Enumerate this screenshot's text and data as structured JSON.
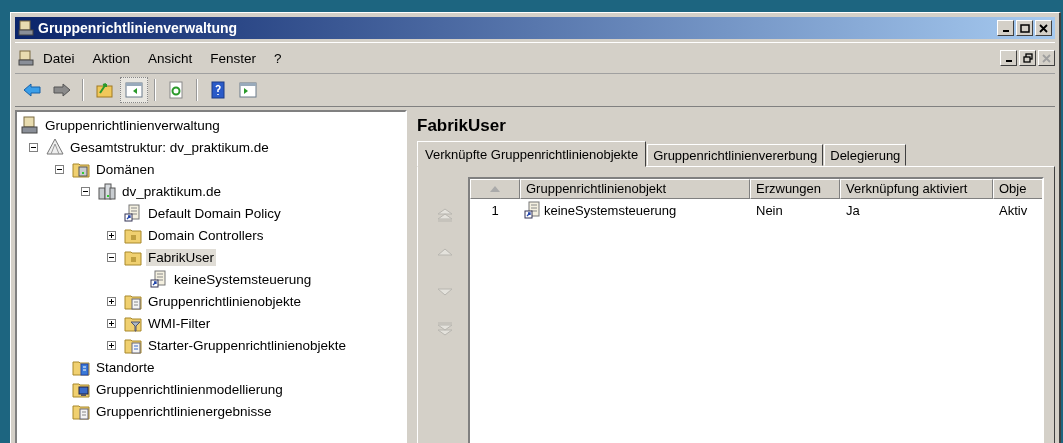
{
  "window": {
    "title": "Gruppenrichtlinienverwaltung"
  },
  "menu": [
    "Datei",
    "Aktion",
    "Ansicht",
    "Fenster",
    "?"
  ],
  "toolbar": [
    {
      "kind": "back",
      "disabled": false
    },
    {
      "kind": "forward",
      "disabled": true
    },
    {
      "kind": "sep"
    },
    {
      "kind": "up-folder"
    },
    {
      "kind": "tree-toggle",
      "selected": true
    },
    {
      "kind": "sep"
    },
    {
      "kind": "refresh"
    },
    {
      "kind": "sep"
    },
    {
      "kind": "help"
    },
    {
      "kind": "action-pane"
    }
  ],
  "tree": [
    {
      "label": "Gruppenrichtlinienverwaltung",
      "kind": "console",
      "selected": false,
      "children": [
        {
          "label": "Gesamtstruktur: dv_praktikum.de",
          "kind": "forest",
          "expanded": true,
          "selected": false,
          "children": [
            {
              "label": "Domänen",
              "kind": "domains",
              "expanded": true,
              "selected": false,
              "children": [
                {
                  "label": "dv_praktikum.de",
                  "kind": "domain",
                  "expanded": true,
                  "selected": false,
                  "children": [
                    {
                      "label": "Default Domain Policy",
                      "kind": "gpo-link",
                      "selected": false
                    },
                    {
                      "label": "Domain Controllers",
                      "kind": "ou",
                      "expanded": false,
                      "selected": false
                    },
                    {
                      "label": "FabrikUser",
                      "kind": "ou",
                      "expanded": true,
                      "selected": true,
                      "children": [
                        {
                          "label": "keineSystemsteuerung",
                          "kind": "gpo-link",
                          "selected": false
                        }
                      ]
                    },
                    {
                      "label": "Gruppenrichtlinienobjekte",
                      "kind": "gpo-folder",
                      "expanded": false,
                      "selected": false
                    },
                    {
                      "label": "WMI-Filter",
                      "kind": "wmi",
                      "expanded": false,
                      "selected": false
                    },
                    {
                      "label": "Starter-Gruppenrichtlinienobjekte",
                      "kind": "starter",
                      "expanded": false,
                      "selected": false
                    }
                  ]
                }
              ]
            },
            {
              "label": "Standorte",
              "kind": "sites",
              "selected": false
            },
            {
              "label": "Gruppenrichtlinienmodellierung",
              "kind": "modeling",
              "selected": false
            },
            {
              "label": "Gruppenrichtlinienergebnisse",
              "kind": "results",
              "selected": false
            }
          ]
        }
      ]
    }
  ],
  "detail": {
    "title": "FabrikUser",
    "tabs": [
      {
        "label": "Verknüpfte Gruppenrichtlinienobjekte",
        "selected": true
      },
      {
        "label": "Gruppenrichtlinienvererbung",
        "selected": false
      },
      {
        "label": "Delegierung",
        "selected": false
      }
    ],
    "order_buttons": [
      {
        "kind": "top",
        "disabled": true
      },
      {
        "kind": "up",
        "disabled": true
      },
      {
        "kind": "down",
        "disabled": true
      },
      {
        "kind": "bottom",
        "disabled": true
      }
    ],
    "table": {
      "columns": [
        "Gruppenrichtlinienobjekt",
        "Erzwungen",
        "Verknüpfung aktiviert",
        "Obje"
      ],
      "rows": [
        {
          "order": "1",
          "gpo": "keineSystemsteuerung",
          "enforced": "Nein",
          "link_enabled": "Ja",
          "column_5": "Aktiv"
        }
      ]
    }
  }
}
